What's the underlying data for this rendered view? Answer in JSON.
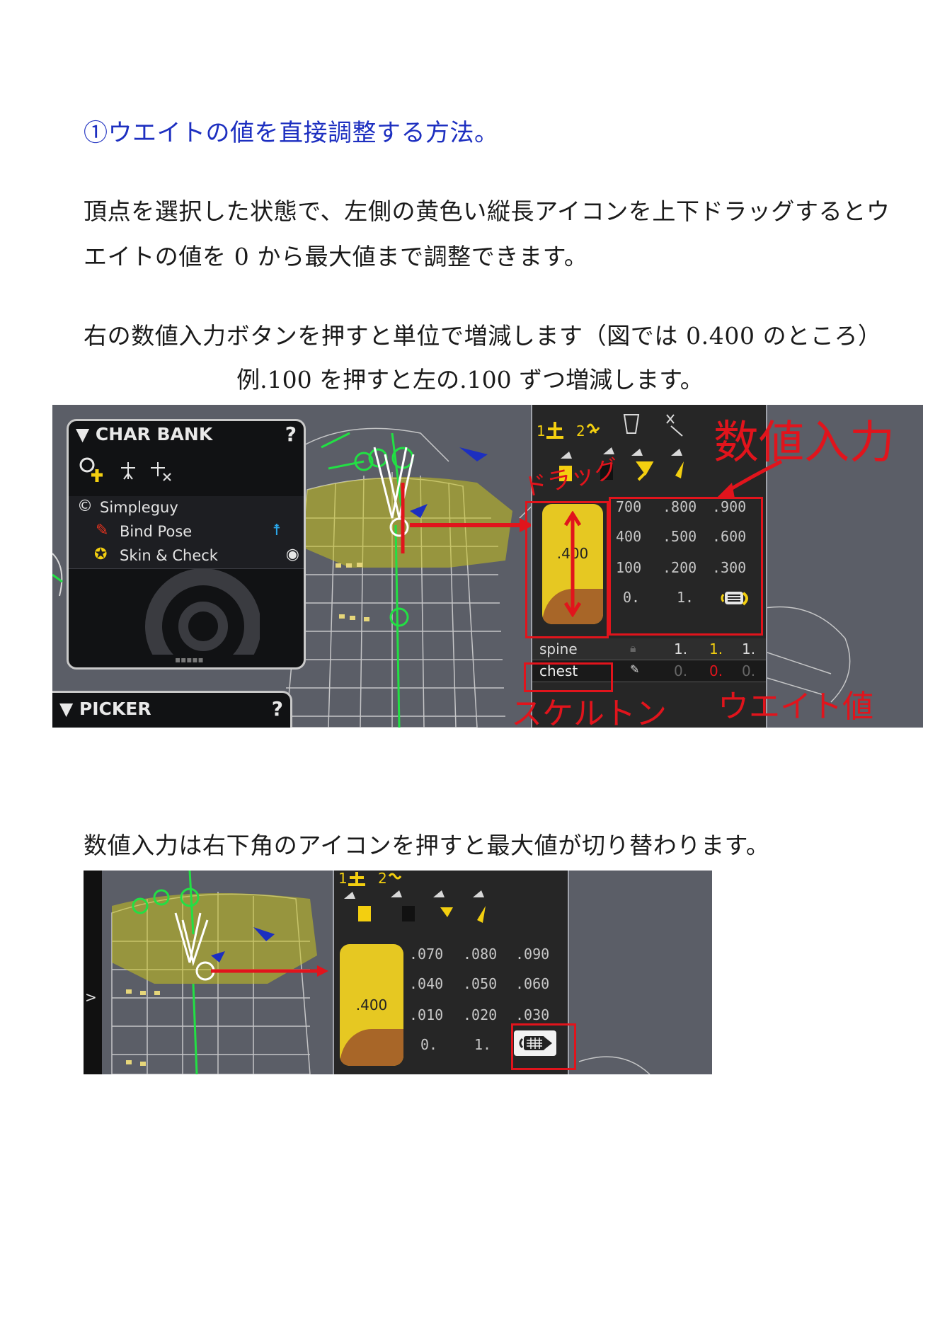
{
  "heading": "①ウエイトの値を直接調整する方法。",
  "paragraphs": {
    "p1_line1": "頂点を選択した状態で、左側の黄色い縦長アイコンを上下ドラッグするとウ",
    "p1_line2": "エイトの値を 0 から最大値まで調整できます。",
    "p2_line1": "右の数値入力ボタンを押すと単位で増減します（図では 0.400 のところ）",
    "p2_line2": "例.100 を押すと左の.100 ずつ増減します。",
    "p3": "数値入力は右下角のアイコンを押すと最大値が切り替わります。"
  },
  "screenshot1": {
    "char_bank": {
      "title": "▼ CHAR BANK",
      "help": "?",
      "items": [
        {
          "label": "Simpleguy",
          "icon": "character-c-icon"
        },
        {
          "label": "Bind Pose",
          "icon": "bone-icon"
        },
        {
          "label": "Skin & Check",
          "icon": "skin-check-icon"
        }
      ]
    },
    "picker": {
      "title": "▼ PICKER",
      "help": "?"
    },
    "slider_value": ".400",
    "numpad": [
      [
        "700",
        ".800",
        ".900"
      ],
      [
        "400",
        ".500",
        ".600"
      ],
      [
        "100",
        ".200",
        ".300"
      ],
      [
        "0.",
        "1."
      ]
    ],
    "weights": [
      {
        "bone": "spine",
        "values": [
          "1.",
          "1.",
          "1."
        ]
      },
      {
        "bone": "chest",
        "values": [
          "0.",
          "0.",
          "0."
        ]
      }
    ],
    "annotations": {
      "numeric_input": "数値入力",
      "drag": "ドラッグ",
      "skeleton": "スケルトン",
      "weight_value": "ウエイト値"
    },
    "colors": {
      "slider_yellow": "#e6c822",
      "annotation_red": "#e1141c",
      "panel_dark": "#262626"
    }
  },
  "screenshot2": {
    "slider_value": ".400",
    "numpad": [
      [
        ".070",
        ".080",
        ".090"
      ],
      [
        ".040",
        ".050",
        ".060"
      ],
      [
        ".010",
        ".020",
        ".030"
      ],
      [
        "0.",
        "1."
      ]
    ]
  }
}
